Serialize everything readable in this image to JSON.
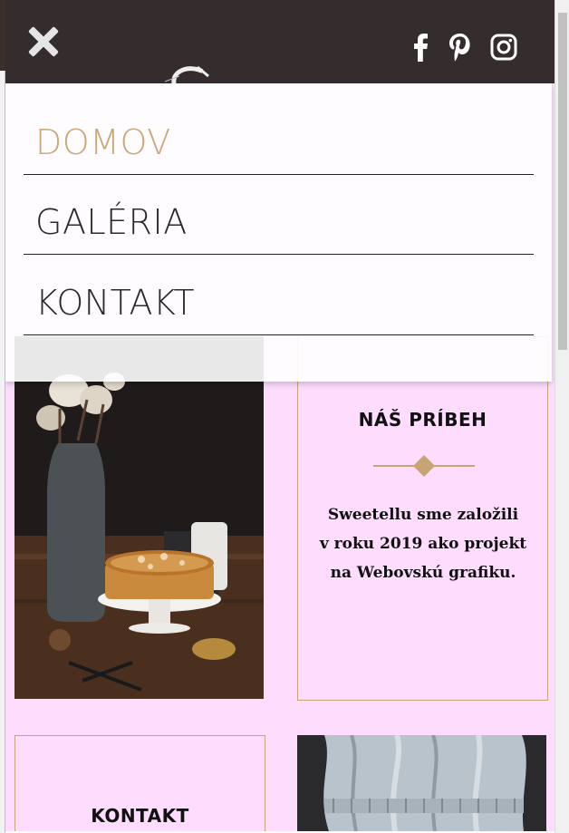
{
  "header": {
    "close_icon": "close-x-icon",
    "social": [
      {
        "name": "facebook",
        "icon": "facebook-icon"
      },
      {
        "name": "pinterest",
        "icon": "pinterest-icon"
      },
      {
        "name": "instagram",
        "icon": "instagram-icon"
      }
    ]
  },
  "menu": {
    "items": [
      {
        "label": "DOMOV",
        "active": true
      },
      {
        "label": "GALÉRIA",
        "active": false
      },
      {
        "label": "KONTAKT",
        "active": false
      }
    ]
  },
  "story_card": {
    "title": "NÁŠ PRÍBEH",
    "lines": [
      "Sweetellu sme založili",
      "v roku 2019 ako projekt",
      "na Webovskú grafiku."
    ]
  },
  "contact_card": {
    "title": "KONTAKT"
  },
  "colors": {
    "header_bg": "#342c2d",
    "page_bg": "#fddcfd",
    "accent_gold": "#caa876",
    "menu_bg": "#ffffff"
  }
}
